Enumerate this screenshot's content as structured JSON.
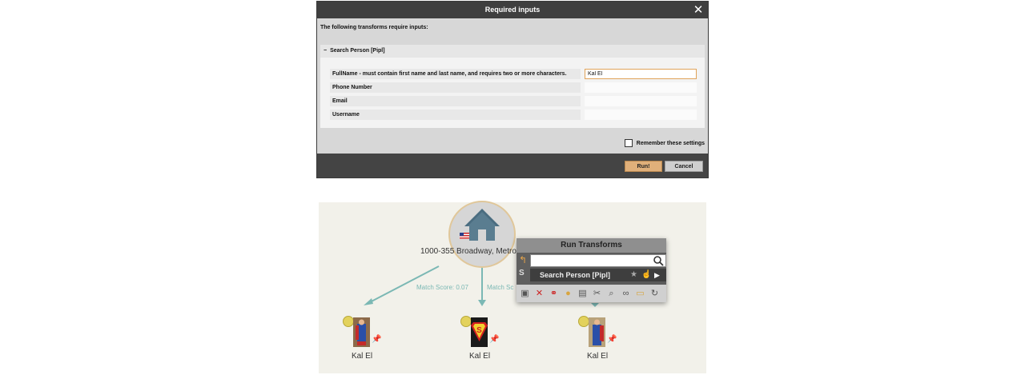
{
  "dialog": {
    "title": "Required inputs",
    "intro": "The following transforms require inputs:",
    "section_title": "Search Person [Pipl]",
    "fields": [
      {
        "label": "FullName - must contain first name and last name, and requires two or more characters.",
        "value": "Kal El"
      },
      {
        "label": "Phone Number",
        "value": ""
      },
      {
        "label": "Email",
        "value": ""
      },
      {
        "label": "Username",
        "value": ""
      }
    ],
    "remember_label": "Remember these settings",
    "run_label": "Run!",
    "cancel_label": "Cancel"
  },
  "graph": {
    "address": "1000-355 Broadway, Metro",
    "match_labels": [
      "Match Score: 0.07",
      "Match Sc"
    ],
    "entities": [
      {
        "name": "Kal El"
      },
      {
        "name": "Kal El"
      },
      {
        "name": "Kal El"
      }
    ]
  },
  "run_transforms": {
    "title": "Run Transforms",
    "search_placeholder": "",
    "item_label": "Search Person [Pipl]",
    "side_label": "S"
  },
  "colors": {
    "accent": "#e0b07a",
    "title_bar": "#3f3f3f",
    "edge": "#7bb8b4",
    "node_dot": "#e3d25c"
  }
}
